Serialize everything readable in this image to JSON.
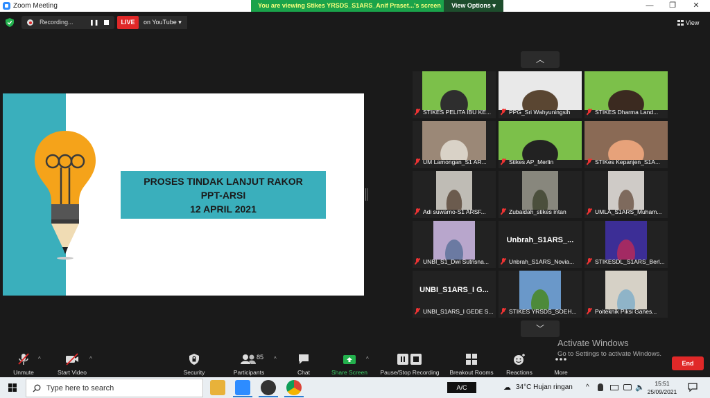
{
  "window": {
    "title": "Zoom Meeting",
    "minimize": "—",
    "restore": "❐",
    "close": "✕"
  },
  "share_banner": {
    "text": "You are viewing Stikes YRSDS_S1ARS_Anif Praset...'s screen",
    "view_options": "View Options ▾"
  },
  "topbar": {
    "recording_label": "Recording...",
    "pause_glyph": "❚❚",
    "live_label": "LIVE",
    "youtube_label": "on YouTube ▾",
    "view_label": "View"
  },
  "slide": {
    "title_line1": "PROSES TINDAK  LANJUT RAKOR",
    "title_line2": "PPT-ARSI",
    "title_line3": "12 APRIL 2021"
  },
  "gallery": {
    "up_arrow": "︿",
    "down_arrow": "﹀",
    "tiles": [
      {
        "name": "STIKES PELITA IBU KE..."
      },
      {
        "name": "PPG_Sri Wahyuningsih"
      },
      {
        "name": "STIKES Dharma Land..."
      },
      {
        "name": "UM Lamongan_S1 AR..."
      },
      {
        "name": "Stikes AP_Merlin"
      },
      {
        "name": "STIKes Kepanjen_S1A..."
      },
      {
        "name": "Adi suwarno-S1 ARSF..."
      },
      {
        "name": "Zubaidah_stikes intan"
      },
      {
        "name": "UMLA_S1ARS_Muham..."
      },
      {
        "name": "UNBI_S1_Dwi Sutrisna..."
      },
      {
        "name": "Unbrah_S1ARS_Novia...",
        "display": "Unbrah_S1ARS_..."
      },
      {
        "name": "STIKESDL_S1ARS_Berl..."
      },
      {
        "name": "UNBI_S1ARS_I GEDE S...",
        "display": "UNBI_S1ARS_I G..."
      },
      {
        "name": "STIKES YRSDS_SOEH..."
      },
      {
        "name": "Poiteknik Piksi Ganes..."
      }
    ]
  },
  "watermark": {
    "heading": "Activate Windows",
    "sub": "Go to Settings to activate Windows."
  },
  "toolbar": {
    "unmute": "Unmute",
    "start_video": "Start Video",
    "security": "Security",
    "participants": "Participants",
    "participants_count": "85",
    "chat": "Chat",
    "share_screen": "Share Screen",
    "pause_recording": "Pause/Stop Recording",
    "breakout_rooms": "Breakout Rooms",
    "reactions": "Reactions",
    "more": "More",
    "end": "End",
    "caret": "^"
  },
  "taskbar": {
    "search_placeholder": "Type here to search",
    "ac_label": "A/C",
    "weather": "34°C  Hujan ringan",
    "tray_chevron": "^",
    "time": "15:51",
    "date": "25/09/2021"
  },
  "colors": {
    "accent_teal": "#3aafbc",
    "live_red": "#e02828",
    "banner_green": "#1aa34a",
    "zoom_blue": "#2d8cff"
  }
}
